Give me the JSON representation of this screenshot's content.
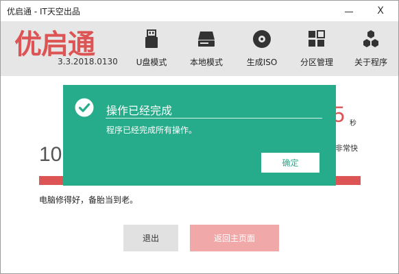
{
  "window": {
    "title": "优启通 - IT天空出品",
    "minimize_icon": "minimize-icon",
    "close_label": "X"
  },
  "header": {
    "logo_text": "优启通",
    "version": "3.3.2018.0130",
    "tools": [
      {
        "label": "U盘模式",
        "icon": "usb-drive-icon"
      },
      {
        "label": "本地模式",
        "icon": "hard-disk-icon"
      },
      {
        "label": "生成ISO",
        "icon": "disc-icon"
      },
      {
        "label": "分区管理",
        "icon": "partition-grid-icon"
      },
      {
        "label": "关于程序",
        "icon": "hexagons-icon"
      }
    ]
  },
  "main": {
    "partial_number": "10",
    "partial_seconds_value": "5",
    "seconds_unit": "秒",
    "partial_fast_text": "非常快",
    "progress_fraction": 1.0,
    "slogan": "电脑修得好，备胎当到老。",
    "exit_button": "退出",
    "home_button": "返回主页面"
  },
  "dialog": {
    "title": "操作已经完成",
    "message": "程序已经完成所有操作。",
    "ok_button": "确定",
    "icon": "check-circle-icon"
  },
  "colors": {
    "brand_red": "#dc5454",
    "dialog_green": "#26ac8a",
    "toolbar_bg": "#e6e6e6"
  }
}
